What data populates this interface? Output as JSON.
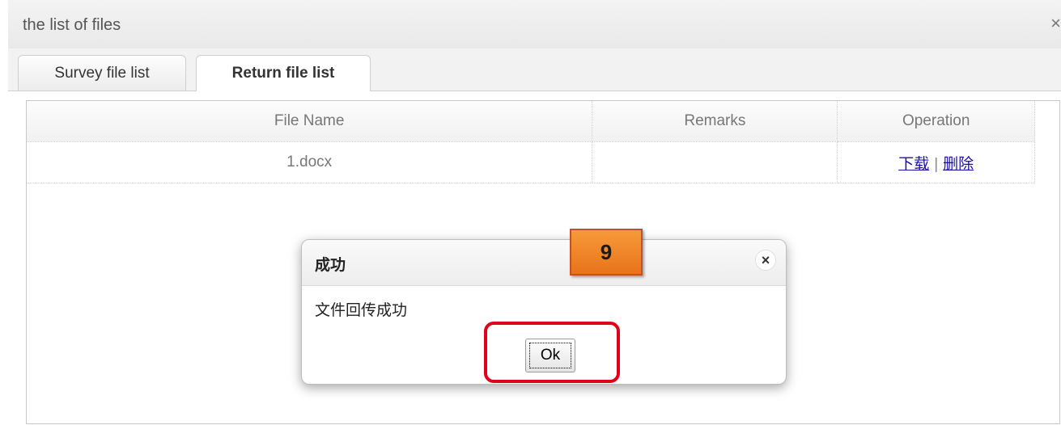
{
  "window": {
    "title": "the list of files",
    "close_label": "×"
  },
  "tabs": [
    {
      "label": "Survey file list",
      "active": false
    },
    {
      "label": "Return file list",
      "active": true
    }
  ],
  "table": {
    "headers": [
      "File Name",
      "Remarks",
      "Operation"
    ],
    "rows": [
      {
        "file_name": "1.docx",
        "remarks": "",
        "ops": [
          "下载",
          "删除"
        ],
        "separator": "|"
      }
    ]
  },
  "dialog": {
    "title": "成功",
    "message": "文件回传成功",
    "ok_label": "Ok",
    "close_label": "×"
  },
  "annotation": {
    "step_number": "9",
    "badge_color": "#f08a2a",
    "highlight_color": "#e0001a"
  }
}
